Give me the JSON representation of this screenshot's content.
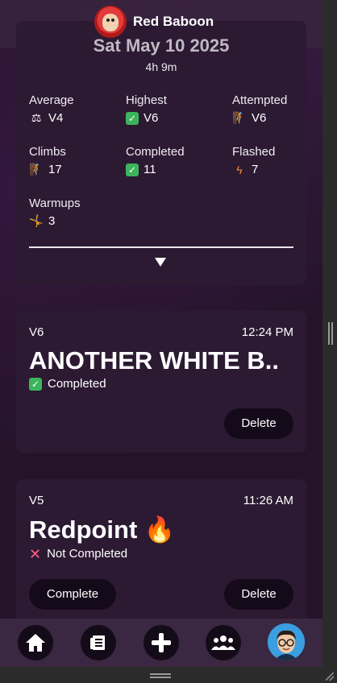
{
  "brand": {
    "name": "Red Baboon",
    "logo_icon": "baboon-logo"
  },
  "session": {
    "date": "Sat May 10 2025",
    "duration": "4h 9m",
    "stats": {
      "average": {
        "label": "Average",
        "value": "V4",
        "icon": "balance-scale-icon"
      },
      "highest": {
        "label": "Highest",
        "value": "V6",
        "icon": "check-box-icon"
      },
      "attempted": {
        "label": "Attempted",
        "value": "V6",
        "icon": "climber-icon"
      },
      "climbs": {
        "label": "Climbs",
        "value": "17",
        "icon": "climber-icon"
      },
      "completed": {
        "label": "Completed",
        "value": "11",
        "icon": "check-box-icon"
      },
      "flashed": {
        "label": "Flashed",
        "value": "7",
        "icon": "lightning-icon"
      },
      "warmups": {
        "label": "Warmups",
        "value": "3",
        "icon": "stretch-icon"
      }
    }
  },
  "climbs": [
    {
      "grade": "V6",
      "time": "12:24 PM",
      "name": "ANOTHER WHITE B..",
      "status": "Completed",
      "delete_label": "Delete"
    },
    {
      "grade": "V5",
      "time": "11:26 AM",
      "name": "Redpoint 🔥",
      "status": "Not Completed",
      "complete_label": "Complete",
      "delete_label": "Delete"
    }
  ],
  "nav": {
    "items": [
      "home-icon",
      "journal-icon",
      "add-icon",
      "community-icon",
      "profile-avatar"
    ]
  },
  "colors": {
    "background": "#241329",
    "card": "#2c1a33",
    "button": "#150a1a",
    "check": "#3cb45d",
    "cross": "#ff5f8a"
  }
}
